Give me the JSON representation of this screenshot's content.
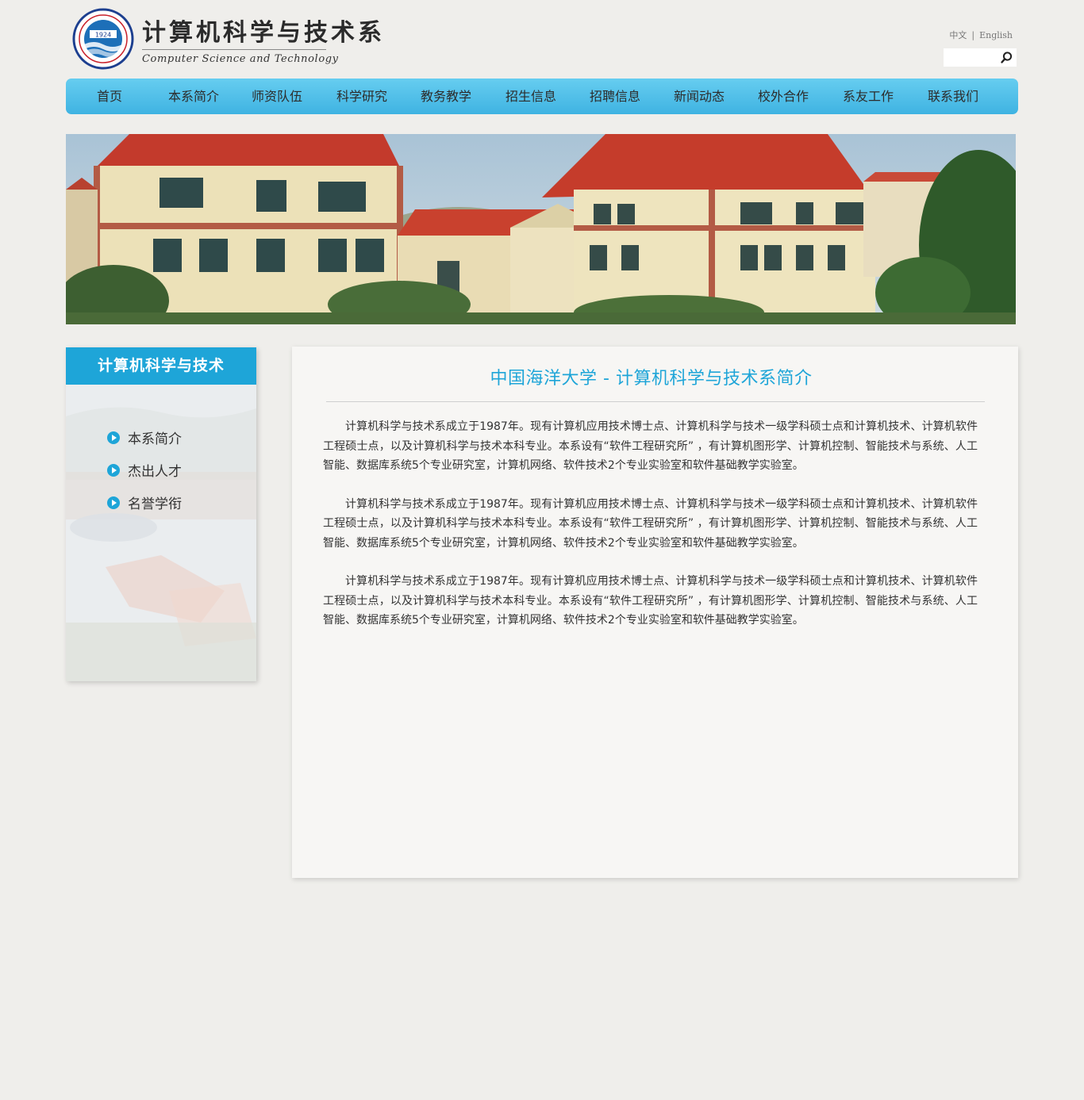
{
  "header": {
    "logo_cn": "计算机科学与技术系",
    "logo_en": "Computer Science and Technology",
    "seal_text": "1924",
    "lang_cn": "中文",
    "lang_sep": "|",
    "lang_en": "English",
    "search_placeholder": ""
  },
  "nav": {
    "items": [
      "首页",
      "本系简介",
      "师资队伍",
      "科学研究",
      "教务教学",
      "招生信息",
      "招聘信息",
      "新闻动态",
      "校外合作",
      "系友工作",
      "联系我们"
    ]
  },
  "sidebar": {
    "title": "计算机科学与技术",
    "items": [
      {
        "label": "本系简介"
      },
      {
        "label": "杰出人才"
      },
      {
        "label": "名誉学衔"
      }
    ]
  },
  "content": {
    "title": "中国海洋大学 - 计算机科学与技术系简介",
    "paragraphs": [
      "计算机科学与技术系成立于1987年。现有计算机应用技术博士点、计算机科学与技术一级学科硕士点和计算机技术、计算机软件工程硕士点，以及计算机科学与技术本科专业。本系设有“软件工程研究所” ，有计算机图形学、计算机控制、智能技术与系统、人工智能、数据库系统5个专业研究室，计算机网络、软件技术2个专业实验室和软件基础教学实验室。",
      "计算机科学与技术系成立于1987年。现有计算机应用技术博士点、计算机科学与技术一级学科硕士点和计算机技术、计算机软件工程硕士点，以及计算机科学与技术本科专业。本系设有“软件工程研究所” ，有计算机图形学、计算机控制、智能技术与系统、人工智能、数据库系统5个专业研究室，计算机网络、软件技术2个专业实验室和软件基础教学实验室。",
      "计算机科学与技术系成立于1987年。现有计算机应用技术博士点、计算机科学与技术一级学科硕士点和计算机技术、计算机软件工程硕士点，以及计算机科学与技术本科专业。本系设有“软件工程研究所” ，有计算机图形学、计算机控制、智能技术与系统、人工智能、数据库系统5个专业研究室，计算机网络、软件技术2个专业实验室和软件基础教学实验室。"
    ]
  },
  "colors": {
    "accent": "#1ea5d8",
    "nav_top": "#66cdf0",
    "nav_bottom": "#3fb3e2",
    "page_bg": "#efeeeb",
    "content_bg": "#f7f6f4"
  },
  "icons": {
    "search": "search-icon",
    "seal": "university-seal-icon",
    "bullet": "play-circle-icon"
  }
}
